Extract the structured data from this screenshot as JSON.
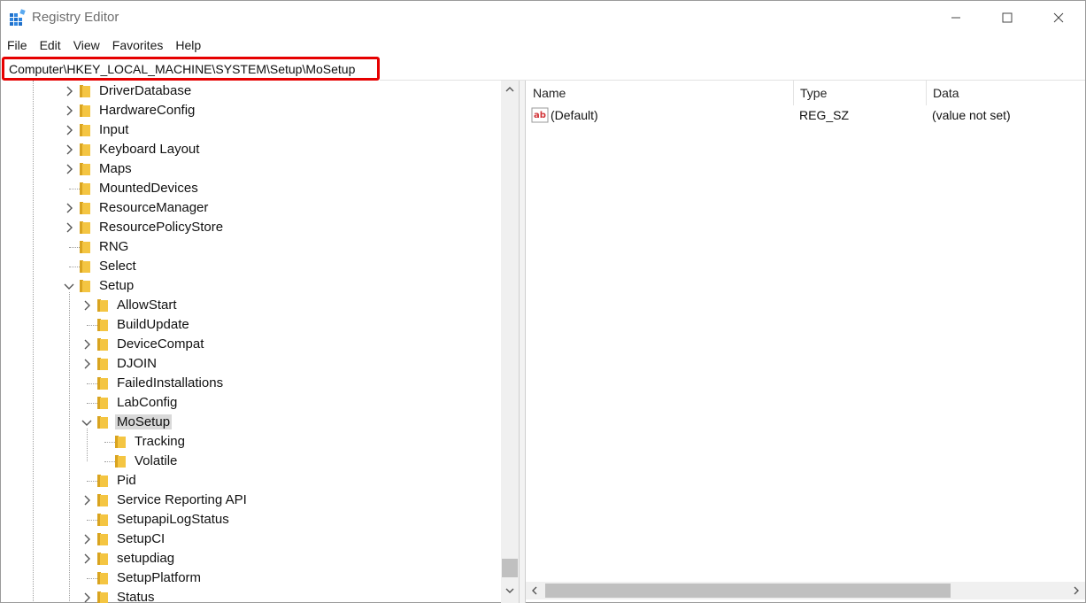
{
  "window": {
    "title": "Registry Editor",
    "controls": {
      "minimize": "minimize",
      "maximize": "maximize",
      "close": "close"
    }
  },
  "menu": [
    "File",
    "Edit",
    "View",
    "Favorites",
    "Help"
  ],
  "address": "Computer\\HKEY_LOCAL_MACHINE\\SYSTEM\\Setup\\MoSetup",
  "tree": {
    "items": [
      {
        "label": "DriverDatabase",
        "level": 0,
        "expander": "collapsed"
      },
      {
        "label": "HardwareConfig",
        "level": 0,
        "expander": "collapsed"
      },
      {
        "label": "Input",
        "level": 0,
        "expander": "collapsed"
      },
      {
        "label": "Keyboard Layout",
        "level": 0,
        "expander": "collapsed"
      },
      {
        "label": "Maps",
        "level": 0,
        "expander": "collapsed"
      },
      {
        "label": "MountedDevices",
        "level": 0,
        "expander": "none"
      },
      {
        "label": "ResourceManager",
        "level": 0,
        "expander": "collapsed"
      },
      {
        "label": "ResourcePolicyStore",
        "level": 0,
        "expander": "collapsed"
      },
      {
        "label": "RNG",
        "level": 0,
        "expander": "none"
      },
      {
        "label": "Select",
        "level": 0,
        "expander": "none"
      },
      {
        "label": "Setup",
        "level": 0,
        "expander": "expanded"
      },
      {
        "label": "AllowStart",
        "level": 1,
        "expander": "collapsed"
      },
      {
        "label": "BuildUpdate",
        "level": 1,
        "expander": "none"
      },
      {
        "label": "DeviceCompat",
        "level": 1,
        "expander": "collapsed"
      },
      {
        "label": "DJOIN",
        "level": 1,
        "expander": "collapsed"
      },
      {
        "label": "FailedInstallations",
        "level": 1,
        "expander": "none"
      },
      {
        "label": "LabConfig",
        "level": 1,
        "expander": "none"
      },
      {
        "label": "MoSetup",
        "level": 1,
        "expander": "expanded",
        "selected": true
      },
      {
        "label": "Tracking",
        "level": 2,
        "expander": "none"
      },
      {
        "label": "Volatile",
        "level": 2,
        "expander": "none"
      },
      {
        "label": "Pid",
        "level": 1,
        "expander": "none"
      },
      {
        "label": "Service Reporting API",
        "level": 1,
        "expander": "collapsed"
      },
      {
        "label": "SetupapiLogStatus",
        "level": 1,
        "expander": "none"
      },
      {
        "label": "SetupCI",
        "level": 1,
        "expander": "collapsed"
      },
      {
        "label": "setupdiag",
        "level": 1,
        "expander": "collapsed"
      },
      {
        "label": "SetupPlatform",
        "level": 1,
        "expander": "none"
      },
      {
        "label": "Status",
        "level": 1,
        "expander": "collapsed"
      }
    ]
  },
  "values": {
    "columns": [
      "Name",
      "Type",
      "Data"
    ],
    "rows": [
      {
        "name": "(Default)",
        "type": "REG_SZ",
        "data": "(value not set)",
        "icon": "string-value-icon"
      }
    ]
  },
  "colors": {
    "address_highlight": "#e60000",
    "folder": "#f4c542",
    "selection": "#d9d9d9",
    "scrollbar_thumb": "#c0c0c0"
  }
}
